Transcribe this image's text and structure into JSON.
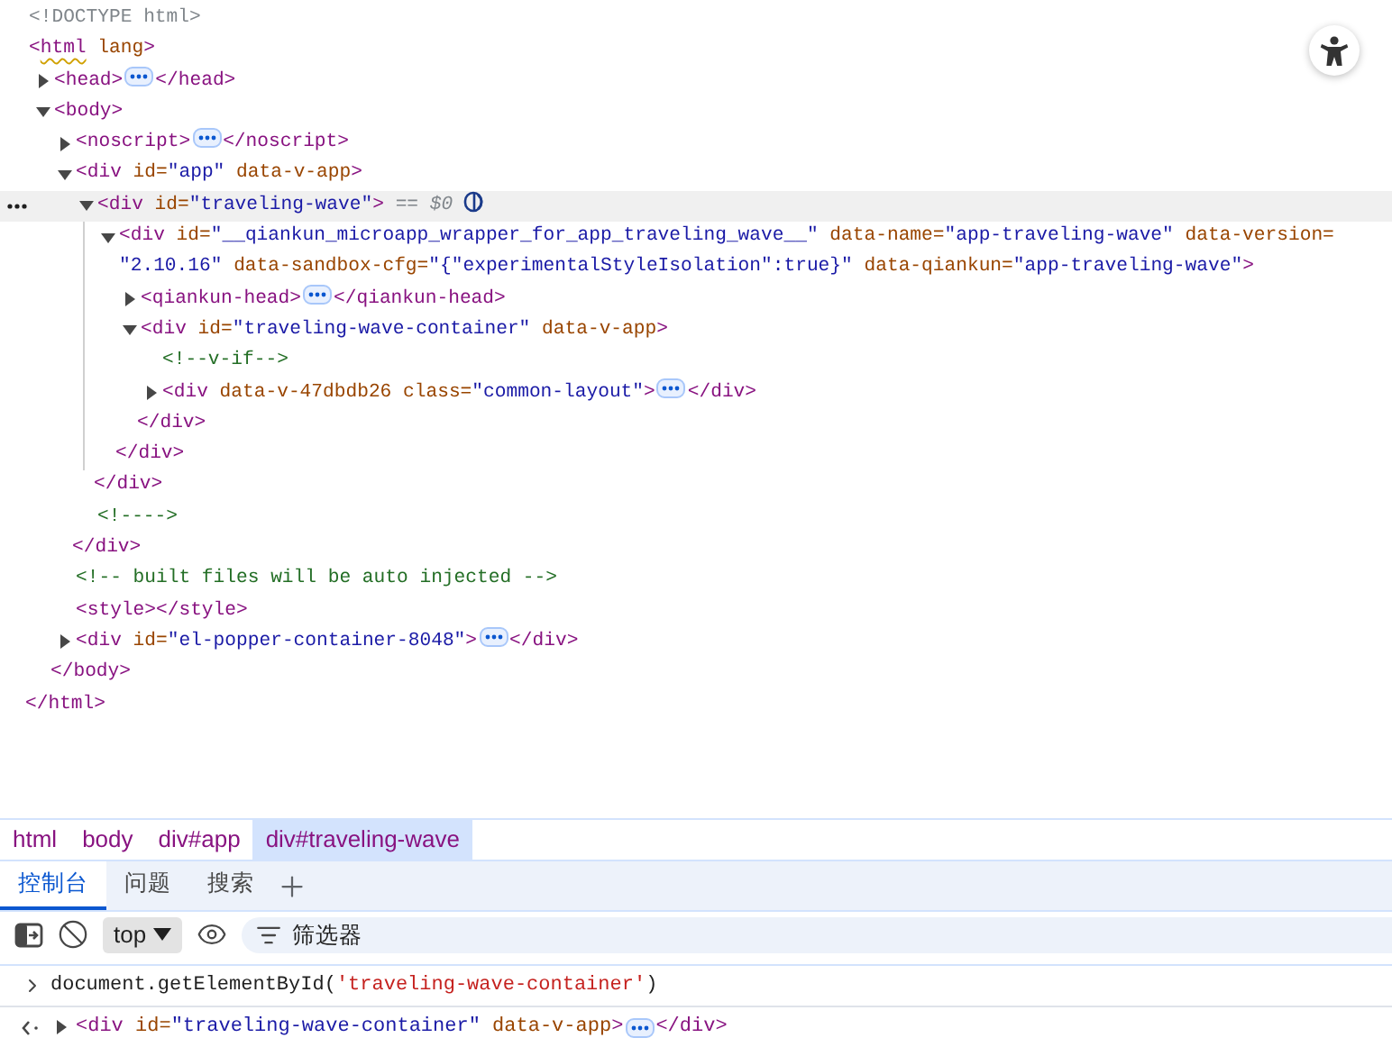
{
  "tree": [
    {
      "selected": false,
      "open": [
        {
          "kind": "doctype",
          "text": "<!DOCTYPE html>"
        }
      ]
    },
    {
      "selected": false,
      "open": [
        {
          "kind": "tag",
          "text": "<"
        },
        {
          "kind": "flagged-tag",
          "text": "html"
        },
        {
          "kind": "attr",
          "text": " lang"
        },
        {
          "kind": "tag",
          "text": ">"
        }
      ],
      "close": [
        {
          "kind": "tag",
          "text": "</html>"
        }
      ],
      "children": [
        {
          "selected": false,
          "expanded": false,
          "open": [
            {
              "kind": "tag",
              "text": "<head>"
            }
          ],
          "close": [
            {
              "kind": "tag",
              "text": "</head>"
            }
          ]
        },
        {
          "selected": false,
          "expanded": true,
          "open": [
            {
              "kind": "tag",
              "text": "<body>"
            }
          ],
          "close": [
            {
              "kind": "tag",
              "text": "</body>"
            }
          ],
          "children": [
            {
              "selected": false,
              "expanded": false,
              "open": [
                {
                  "kind": "tag",
                  "text": "<noscript>"
                }
              ],
              "close": [
                {
                  "kind": "tag",
                  "text": "</noscript>"
                }
              ]
            },
            {
              "selected": false,
              "expanded": true,
              "open": [
                {
                  "kind": "tag",
                  "text": "<div"
                },
                {
                  "kind": "attr",
                  "text": " id="
                },
                {
                  "kind": "value",
                  "text": "\"app\""
                },
                {
                  "kind": "attr",
                  "text": " data-v-app"
                },
                {
                  "kind": "tag",
                  "text": ">"
                }
              ],
              "close": [
                {
                  "kind": "tag",
                  "text": "</div>"
                }
              ],
              "children": [
                {
                  "selected": true,
                  "expanded": true,
                  "reference": "== $0",
                  "open": [
                    {
                      "kind": "tag",
                      "text": "<div"
                    },
                    {
                      "kind": "attr",
                      "text": " id="
                    },
                    {
                      "kind": "value",
                      "text": "\"traveling-wave\""
                    },
                    {
                      "kind": "tag",
                      "text": ">"
                    }
                  ],
                  "close": [
                    {
                      "kind": "tag",
                      "text": "</div>"
                    }
                  ],
                  "children": [
                    {
                      "selected": false,
                      "expanded": true,
                      "open": [
                        {
                          "kind": "tag",
                          "text": "<div"
                        },
                        {
                          "kind": "attr",
                          "text": " id="
                        },
                        {
                          "kind": "value",
                          "text": "\"__qiankun_microapp_wrapper_for_app_traveling_wave__\""
                        },
                        {
                          "kind": "attr",
                          "text": " data-name="
                        },
                        {
                          "kind": "value",
                          "text": "\"app-traveling-wave\""
                        },
                        {
                          "kind": "attr",
                          "text": " data-version="
                        },
                        {
                          "kind": "value",
                          "text": "\"2.10.16\""
                        },
                        {
                          "kind": "attr",
                          "text": " data-sandbox-cfg="
                        },
                        {
                          "kind": "value",
                          "text": "\"{\"experimentalStyleIsolation\":true}\""
                        },
                        {
                          "kind": "attr",
                          "text": " data-qiankun="
                        },
                        {
                          "kind": "value",
                          "text": "\"app-traveling-wave\""
                        },
                        {
                          "kind": "tag",
                          "text": ">"
                        }
                      ],
                      "close": [
                        {
                          "kind": "tag",
                          "text": "</div>"
                        }
                      ],
                      "children": [
                        {
                          "selected": false,
                          "expanded": false,
                          "open": [
                            {
                              "kind": "tag",
                              "text": "<qiankun-head>"
                            }
                          ],
                          "close": [
                            {
                              "kind": "tag",
                              "text": "</qiankun-head>"
                            }
                          ]
                        },
                        {
                          "selected": false,
                          "expanded": true,
                          "open": [
                            {
                              "kind": "tag",
                              "text": "<div"
                            },
                            {
                              "kind": "attr",
                              "text": " id="
                            },
                            {
                              "kind": "value",
                              "text": "\"traveling-wave-container\""
                            },
                            {
                              "kind": "attr",
                              "text": " data-v-app"
                            },
                            {
                              "kind": "tag",
                              "text": ">"
                            }
                          ],
                          "close": [
                            {
                              "kind": "tag",
                              "text": "</div>"
                            }
                          ],
                          "children": [
                            {
                              "selected": false,
                              "open": [
                                {
                                  "kind": "comment",
                                  "text": "<!--v-if-->"
                                }
                              ]
                            },
                            {
                              "selected": false,
                              "expanded": false,
                              "open": [
                                {
                                  "kind": "tag",
                                  "text": "<div"
                                },
                                {
                                  "kind": "attr",
                                  "text": " data-v-47dbdb26 class="
                                },
                                {
                                  "kind": "value",
                                  "text": "\"common-layout\""
                                },
                                {
                                  "kind": "tag",
                                  "text": ">"
                                }
                              ],
                              "close": [
                                {
                                  "kind": "tag",
                                  "text": "</div>"
                                }
                              ]
                            }
                          ]
                        }
                      ]
                    }
                  ]
                },
                {
                  "selected": false,
                  "open": [
                    {
                      "kind": "comment",
                      "text": "<!---->"
                    }
                  ]
                }
              ]
            },
            {
              "selected": false,
              "open": [
                {
                  "kind": "comment",
                  "text": "<!-- built files will be auto injected -->"
                }
              ]
            },
            {
              "selected": false,
              "open": [
                {
                  "kind": "tag",
                  "text": "<style></style>"
                }
              ]
            },
            {
              "selected": false,
              "expanded": false,
              "open": [
                {
                  "kind": "tag",
                  "text": "<div"
                },
                {
                  "kind": "attr",
                  "text": " id="
                },
                {
                  "kind": "value",
                  "text": "\"el-popper-container-8048\""
                },
                {
                  "kind": "tag",
                  "text": ">"
                }
              ],
              "close": [
                {
                  "kind": "tag",
                  "text": "</div>"
                }
              ]
            }
          ]
        }
      ]
    }
  ],
  "breadcrumbs": [
    {
      "label": "html",
      "selected": false
    },
    {
      "label": "body",
      "selected": false
    },
    {
      "label": "div#app",
      "selected": false
    },
    {
      "label": "div#traveling-wave",
      "selected": true
    }
  ],
  "tabs": [
    {
      "label": "控制台",
      "selected": true
    },
    {
      "label": "问题",
      "selected": false
    },
    {
      "label": "搜索",
      "selected": false
    }
  ],
  "toolbar": {
    "context": "top",
    "filter": {
      "placeholder": "筛选器"
    }
  },
  "console": [
    {
      "kind": "input",
      "parts": [
        {
          "kind": "code",
          "text": "document.getElementById("
        },
        {
          "kind": "string",
          "text": "'traveling-wave-container'"
        },
        {
          "kind": "code",
          "text": ")"
        }
      ]
    },
    {
      "kind": "result",
      "expanded": false,
      "open": [
        {
          "kind": "tag",
          "text": "<div"
        },
        {
          "kind": "attr",
          "text": " id="
        },
        {
          "kind": "value",
          "text": "\"traveling-wave-container\""
        },
        {
          "kind": "attr",
          "text": " data-v-app"
        },
        {
          "kind": "tag",
          "text": ">"
        }
      ],
      "close": [
        {
          "kind": "tag",
          "text": "</div>"
        }
      ]
    }
  ]
}
